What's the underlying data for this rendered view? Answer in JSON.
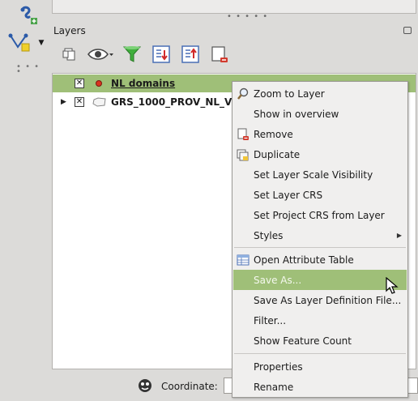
{
  "layers_panel": {
    "title": "Layers",
    "layers": [
      {
        "name": "NL domains",
        "checked": true,
        "symbol_color": "#d9331e"
      },
      {
        "name": "GRS_1000_PROV_NL_V",
        "checked": true
      }
    ]
  },
  "context_menu": {
    "items": [
      {
        "label": "Zoom to Layer",
        "icon": "zoom-icon"
      },
      {
        "label": "Show in overview"
      },
      {
        "label": "Remove",
        "icon": "remove-icon"
      },
      {
        "label": "Duplicate",
        "icon": "duplicate-icon"
      },
      {
        "label": "Set Layer Scale Visibility"
      },
      {
        "label": "Set Layer CRS"
      },
      {
        "label": "Set Project CRS from Layer"
      },
      {
        "label": "Styles",
        "submenu": true
      },
      {
        "label": "Open Attribute Table",
        "icon": "table-icon"
      },
      {
        "label": "Save As...",
        "highlighted": true
      },
      {
        "label": "Save As Layer Definition File..."
      },
      {
        "label": "Filter..."
      },
      {
        "label": "Show Feature Count"
      },
      {
        "label": "Properties"
      },
      {
        "label": "Rename"
      }
    ]
  },
  "status_bar": {
    "coordinate_label": "Coordinate:"
  },
  "colors": {
    "selection": "#9fbf78",
    "menu_bg": "#f0efee",
    "panel_bg": "#dcdbd9"
  }
}
